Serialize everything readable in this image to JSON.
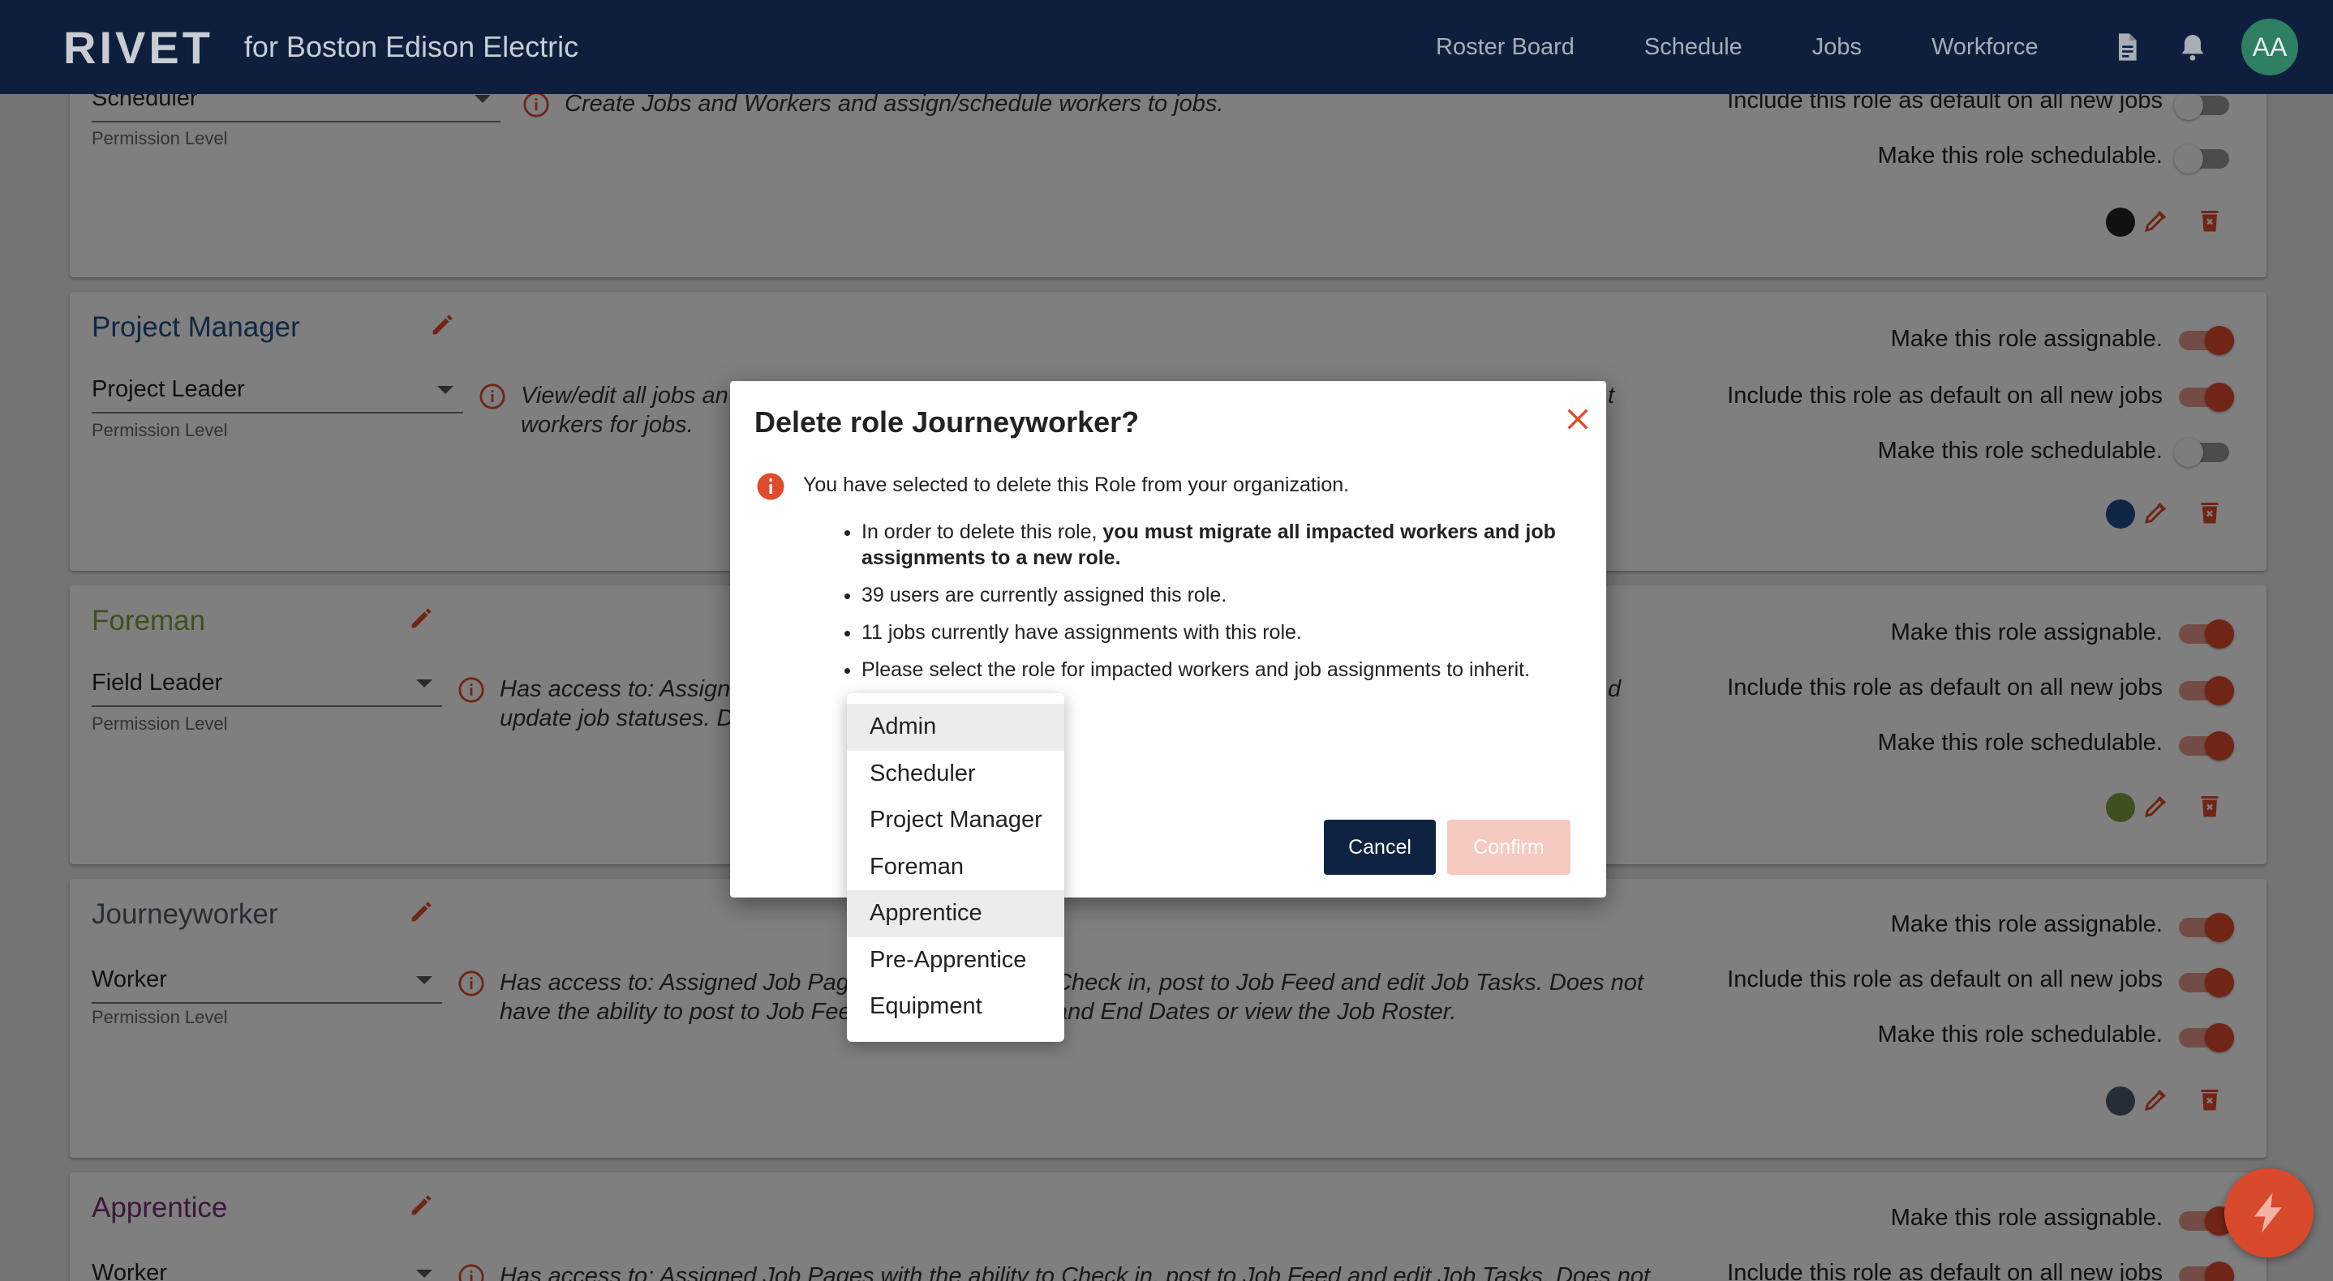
{
  "nav": {
    "brand": "RIVET",
    "subtitle": "for Boston Edison Electric",
    "links": [
      "Roster Board",
      "Schedule",
      "Jobs",
      "Workforce"
    ],
    "avatar_initials": "AA"
  },
  "toggle_labels": {
    "assignable": "Make this role assignable.",
    "default": "Include this role as default on all new jobs",
    "schedulable": "Make this role schedulable."
  },
  "permission_label": "Permission Level",
  "roles": [
    {
      "permission": "Scheduler",
      "description_lines": [
        "Create Jobs and Workers and assign/schedule workers to jobs."
      ],
      "default_on": false,
      "schedulable_on": false,
      "color": "#222222"
    },
    {
      "name": "Project Manager",
      "name_color": "#1f4f8a",
      "permission": "Project Leader",
      "description_lines": [
        "View/edit all jobs an",
        "workers for jobs."
      ],
      "desc_tail": "t",
      "assignable_on": true,
      "default_on": true,
      "schedulable_on": false,
      "color": "#1f4f8a"
    },
    {
      "name": "Foreman",
      "name_color": "#7aa03c",
      "permission": "Field Leader",
      "description_lines": [
        "Has access to: Assign",
        "update job statuses. D"
      ],
      "desc_tail": "d",
      "assignable_on": true,
      "default_on": true,
      "schedulable_on": true,
      "color": "#7aa03c"
    },
    {
      "name": "Journeyworker",
      "name_color": "#4a5d70",
      "permission": "Worker",
      "description_lines": [
        "Has access to: Assigned Job Pag",
        "have the ability to post to Job Fee"
      ],
      "desc_right_lines": [
        "Check in, post to Job Feed and edit Job Tasks. Does not",
        "and End Dates or view the Job Roster."
      ],
      "assignable_on": true,
      "default_on": true,
      "schedulable_on": true,
      "color": "#4a5d70"
    },
    {
      "name": "Apprentice",
      "name_color": "#7a2f7a",
      "permission": "Worker",
      "description_lines": [
        "Has access to: Assigned Job Pages with the ability to Check in, post to Job Feed and edit Job Tasks. Does not"
      ],
      "assignable_on": true,
      "default_on": true
    }
  ],
  "dialog": {
    "title": "Delete role Journeyworker?",
    "intro": "You have selected to delete this Role from your organization.",
    "bullet1_prefix": "In order to delete this role, ",
    "bullet1_bold": "you must migrate all impacted workers and job assignments to a new role.",
    "bullet2": "39 users are currently assigned this role.",
    "bullet3": "11 jobs currently have assignments with this role.",
    "bullet4": "Please select the role for impacted workers and job assignments to inherit.",
    "cancel_label": "Cancel",
    "confirm_label": "Confirm",
    "options": [
      "Admin",
      "Scheduler",
      "Project Manager",
      "Foreman",
      "Apprentice",
      "Pre-Apprentice",
      "Equipment"
    ],
    "highlighted_options": [
      "Admin",
      "Apprentice"
    ]
  },
  "colors": {
    "navbar": "#0d1f3c",
    "accent": "#e04b2c",
    "cancel_button": "#0d2341",
    "avatar": "#2f7f63"
  }
}
